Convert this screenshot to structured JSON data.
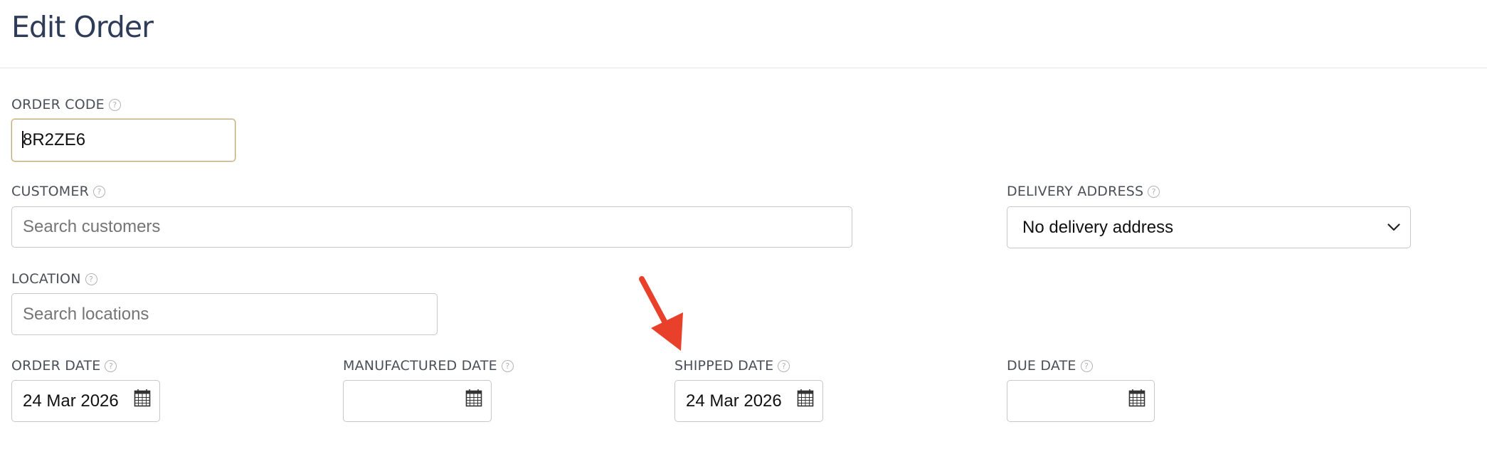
{
  "page": {
    "title": "Edit Order"
  },
  "help_glyph": "?",
  "fields": {
    "order_code": {
      "label": "ORDER CODE",
      "value": "8R2ZE6"
    },
    "customer": {
      "label": "CUSTOMER",
      "placeholder": "Search customers"
    },
    "delivery_address": {
      "label": "DELIVERY ADDRESS",
      "selected": "No delivery address"
    },
    "location": {
      "label": "LOCATION",
      "placeholder": "Search locations"
    },
    "order_date": {
      "label": "ORDER DATE",
      "value": "24 Mar 2026"
    },
    "manufactured_date": {
      "label": "MANUFACTURED DATE",
      "value": ""
    },
    "shipped_date": {
      "label": "SHIPPED DATE",
      "value": "24 Mar 2026"
    },
    "due_date": {
      "label": "DUE DATE",
      "value": ""
    }
  },
  "icons": {
    "help": "question-circle-icon",
    "calendar": "calendar-icon",
    "dropdown": "chevron-down-icon",
    "annotation": "red-arrow"
  },
  "colors": {
    "title": "#2f3c58",
    "label": "#4b4f57",
    "border": "#c7c7c7",
    "focus_border": "#bda97c",
    "placeholder": "#757575",
    "annotation_arrow": "#e8402a"
  }
}
